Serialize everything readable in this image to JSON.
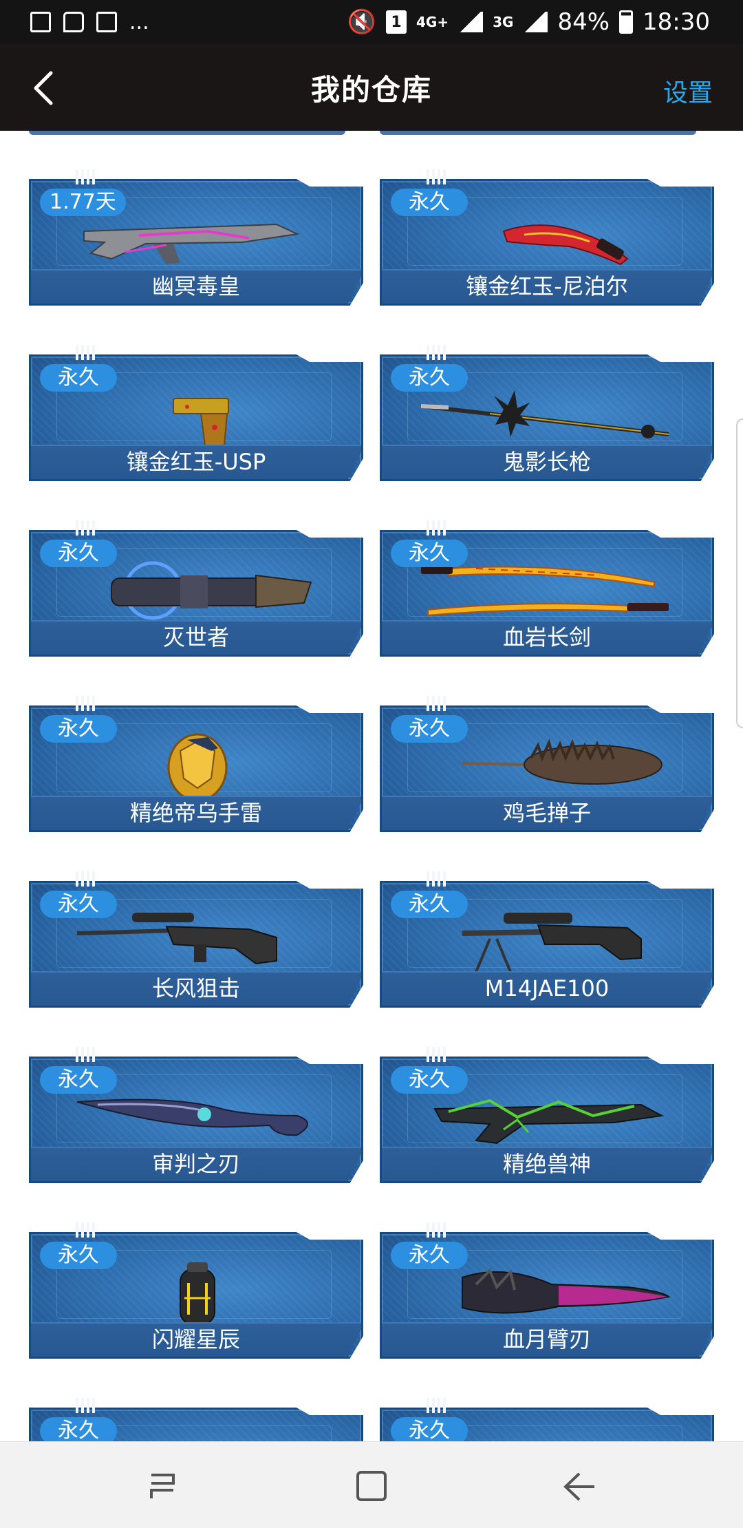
{
  "status_bar": {
    "left_icons": [
      "image-icon",
      "chat-icon",
      "document-icon"
    ],
    "more": "...",
    "sim_slot": "1",
    "net_primary": "4G+",
    "net_secondary": "3G",
    "battery": "84%",
    "time": "18:30"
  },
  "header": {
    "title": "我的仓库",
    "settings_label": "设置"
  },
  "items": [
    {
      "badge": "1.77天",
      "name": "幽冥毒皇",
      "art": "rifle",
      "accent": "#e23bd0"
    },
    {
      "badge": "永久",
      "name": "镶金红玉-尼泊尔",
      "art": "kukri",
      "accent": "#d4262e"
    },
    {
      "badge": "永久",
      "name": "镶金红玉-USP",
      "art": "pistol",
      "accent": "#c8a020"
    },
    {
      "badge": "永久",
      "name": "鬼影长枪",
      "art": "spear",
      "accent": "#222222"
    },
    {
      "badge": "永久",
      "name": "灭世者",
      "art": "gauntlet",
      "accent": "#4f7bd9"
    },
    {
      "badge": "永久",
      "name": "血岩长剑",
      "art": "katana",
      "accent": "#f2b21c"
    },
    {
      "badge": "永久",
      "name": "精绝帝乌手雷",
      "art": "grenade-gold",
      "accent": "#e0a020"
    },
    {
      "badge": "永久",
      "name": "鸡毛掸子",
      "art": "duster",
      "accent": "#4a3a30"
    },
    {
      "badge": "永久",
      "name": "长风狙击",
      "art": "sniper",
      "accent": "#2a2a2a"
    },
    {
      "badge": "永久",
      "name": "M14JAE100",
      "art": "marksman",
      "accent": "#333333"
    },
    {
      "badge": "永久",
      "name": "审判之刃",
      "art": "blade",
      "accent": "#2e3a7a"
    },
    {
      "badge": "永久",
      "name": "精绝兽神",
      "art": "beast-rifle",
      "accent": "#56d13a"
    },
    {
      "badge": "永久",
      "name": "闪耀星辰",
      "art": "grenade-star",
      "accent": "#f2d21c"
    },
    {
      "badge": "永久",
      "name": "血月臂刃",
      "art": "arm-blade",
      "accent": "#d02ca0"
    },
    {
      "badge": "永久",
      "name": "",
      "art": "partial",
      "accent": "#c02020"
    },
    {
      "badge": "永久",
      "name": "",
      "art": "partial",
      "accent": "#c02020"
    }
  ],
  "nav": {
    "recent_label": "recent-apps",
    "home_label": "home",
    "back_label": "back"
  }
}
